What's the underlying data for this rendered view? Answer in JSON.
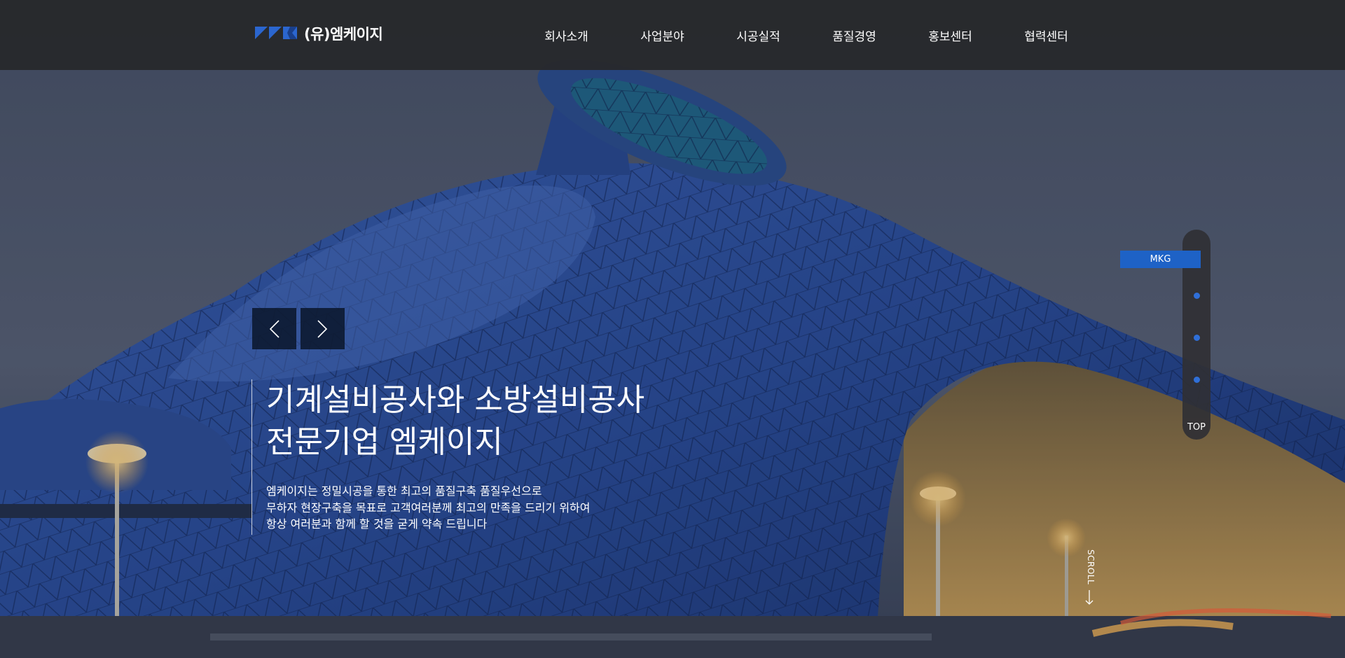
{
  "header": {
    "logo_text": "(유)엠케이지",
    "nav": [
      "회사소개",
      "사업분야",
      "시공실적",
      "품질경영",
      "홍보센터",
      "협력센터"
    ]
  },
  "hero": {
    "title_lines": [
      "기계설비공사와 소방설비공사",
      "전문기업 엠케이지"
    ],
    "desc_lines": [
      "엠케이지는 정밀시공을 통한 최고의 품질구축 품질우선으로",
      "무하자 현장구축을 목표로 고객여러분께 최고의 만족을 드리기 위하여",
      "항상 여러분과 함께 할 것을 굳게 약속 드립니다"
    ]
  },
  "side_nav": {
    "label": "MKG",
    "top_label": "TOP"
  },
  "scroll": {
    "label": "SCROLL"
  },
  "icons": {
    "prev": "chevron-left-icon",
    "next": "chevron-right-icon",
    "scroll": "arrow-down-icon"
  },
  "colors": {
    "accent": "#1e62c6",
    "header_bg": "#28292c",
    "dot": "#2f6fd8"
  }
}
